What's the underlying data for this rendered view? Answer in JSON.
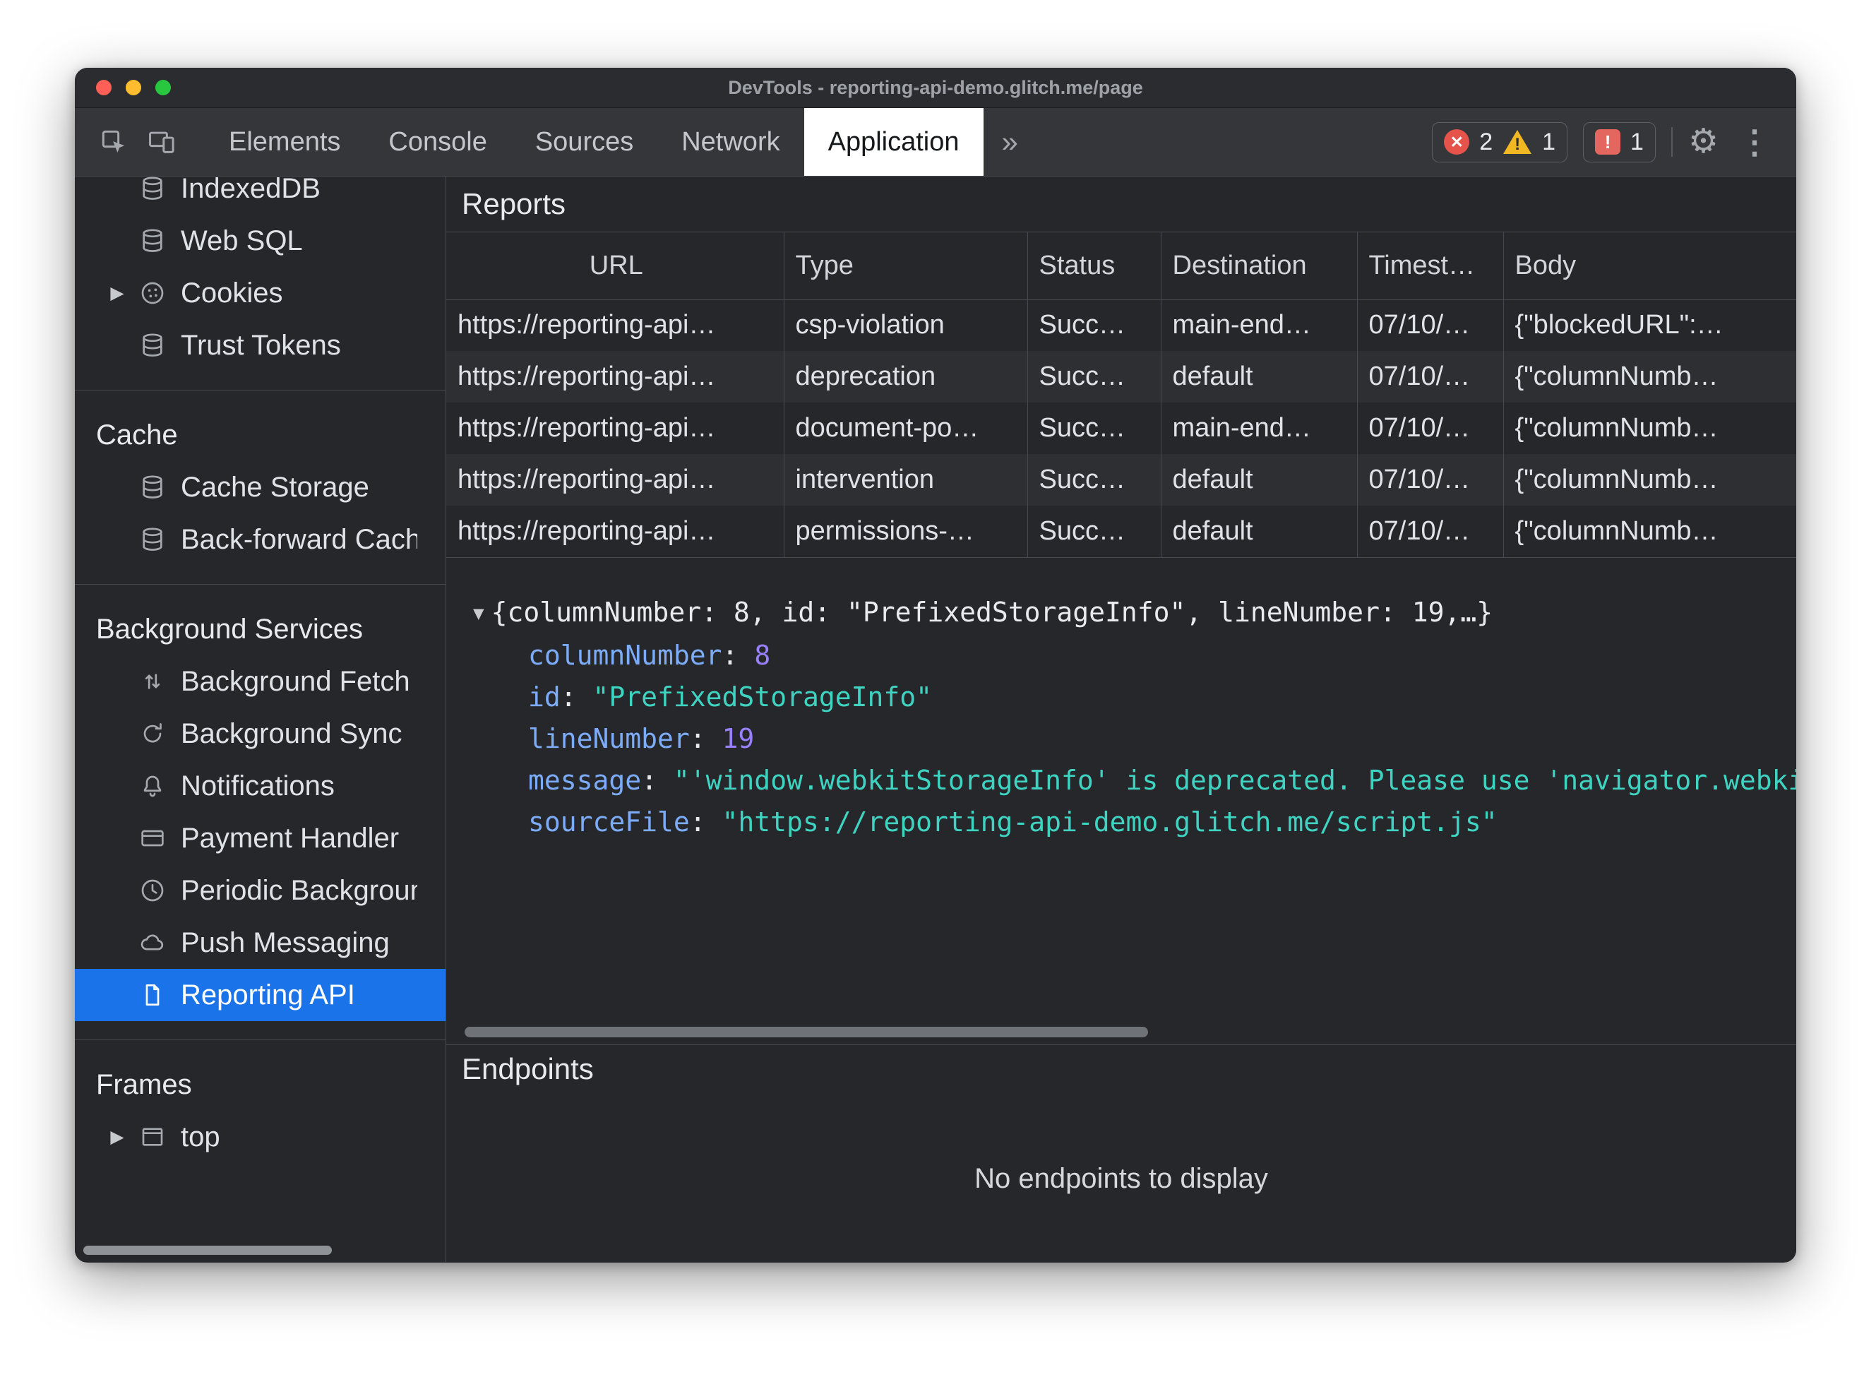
{
  "window": {
    "title": "DevTools - reporting-api-demo.glitch.me/page"
  },
  "toolbar": {
    "tabs": [
      {
        "label": "Elements"
      },
      {
        "label": "Console"
      },
      {
        "label": "Sources"
      },
      {
        "label": "Network"
      },
      {
        "label": "Application",
        "selected": true
      }
    ],
    "more_tabs_label": "»",
    "error_count": "2",
    "warning_count": "1",
    "issue_count": "1"
  },
  "sidebar": {
    "sections": [
      {
        "items": [
          {
            "icon": "database",
            "label": "IndexedDB"
          },
          {
            "icon": "database",
            "label": "Web SQL"
          },
          {
            "icon": "cookie",
            "label": "Cookies",
            "expandable": true
          },
          {
            "icon": "database",
            "label": "Trust Tokens"
          }
        ]
      },
      {
        "header": "Cache",
        "items": [
          {
            "icon": "database",
            "label": "Cache Storage"
          },
          {
            "icon": "database",
            "label": "Back-forward Cache"
          }
        ]
      },
      {
        "header": "Background Services",
        "items": [
          {
            "icon": "background-fetch",
            "label": "Background Fetch"
          },
          {
            "icon": "background-sync",
            "label": "Background Sync"
          },
          {
            "icon": "bell",
            "label": "Notifications"
          },
          {
            "icon": "payment-card",
            "label": "Payment Handler"
          },
          {
            "icon": "clock",
            "label": "Periodic Background Sync"
          },
          {
            "icon": "cloud",
            "label": "Push Messaging"
          },
          {
            "icon": "document",
            "label": "Reporting API",
            "selected": true
          }
        ]
      },
      {
        "header": "Frames",
        "items": [
          {
            "icon": "frame",
            "label": "top",
            "expandable": true
          }
        ]
      }
    ]
  },
  "reports": {
    "title": "Reports",
    "columns": [
      "URL",
      "Type",
      "Status",
      "Destination",
      "Timest…",
      "Body"
    ],
    "rows": [
      [
        "https://reporting-api…",
        "csp-violation",
        "Succ…",
        "main-end…",
        "07/10/…",
        "{\"blockedURL\":…"
      ],
      [
        "https://reporting-api…",
        "deprecation",
        "Succ…",
        "default",
        "07/10/…",
        "{\"columnNumb…"
      ],
      [
        "https://reporting-api…",
        "document-po…",
        "Succ…",
        "main-end…",
        "07/10/…",
        "{\"columnNumb…"
      ],
      [
        "https://reporting-api…",
        "intervention",
        "Succ…",
        "default",
        "07/10/…",
        "{\"columnNumb…"
      ],
      [
        "https://reporting-api…",
        "permissions-…",
        "Succ…",
        "default",
        "07/10/…",
        "{\"columnNumb…"
      ]
    ]
  },
  "detail": {
    "preview": "{columnNumber: 8, id: \"PrefixedStorageInfo\", lineNumber: 19,…}",
    "properties": [
      {
        "key": "columnNumber",
        "value": "8",
        "type": "number"
      },
      {
        "key": "id",
        "value": "\"PrefixedStorageInfo\"",
        "type": "string"
      },
      {
        "key": "lineNumber",
        "value": "19",
        "type": "number"
      },
      {
        "key": "message",
        "value": "\"'window.webkitStorageInfo' is deprecated. Please use 'navigator.webkitTemporaryStorage' or 'navigator.webkitPersistentStorage' instead.\"",
        "type": "string"
      },
      {
        "key": "sourceFile",
        "value": "\"https://reporting-api-demo.glitch.me/script.js\"",
        "type": "string"
      }
    ]
  },
  "endpoints": {
    "title": "Endpoints",
    "empty_message": "No endpoints to display"
  }
}
